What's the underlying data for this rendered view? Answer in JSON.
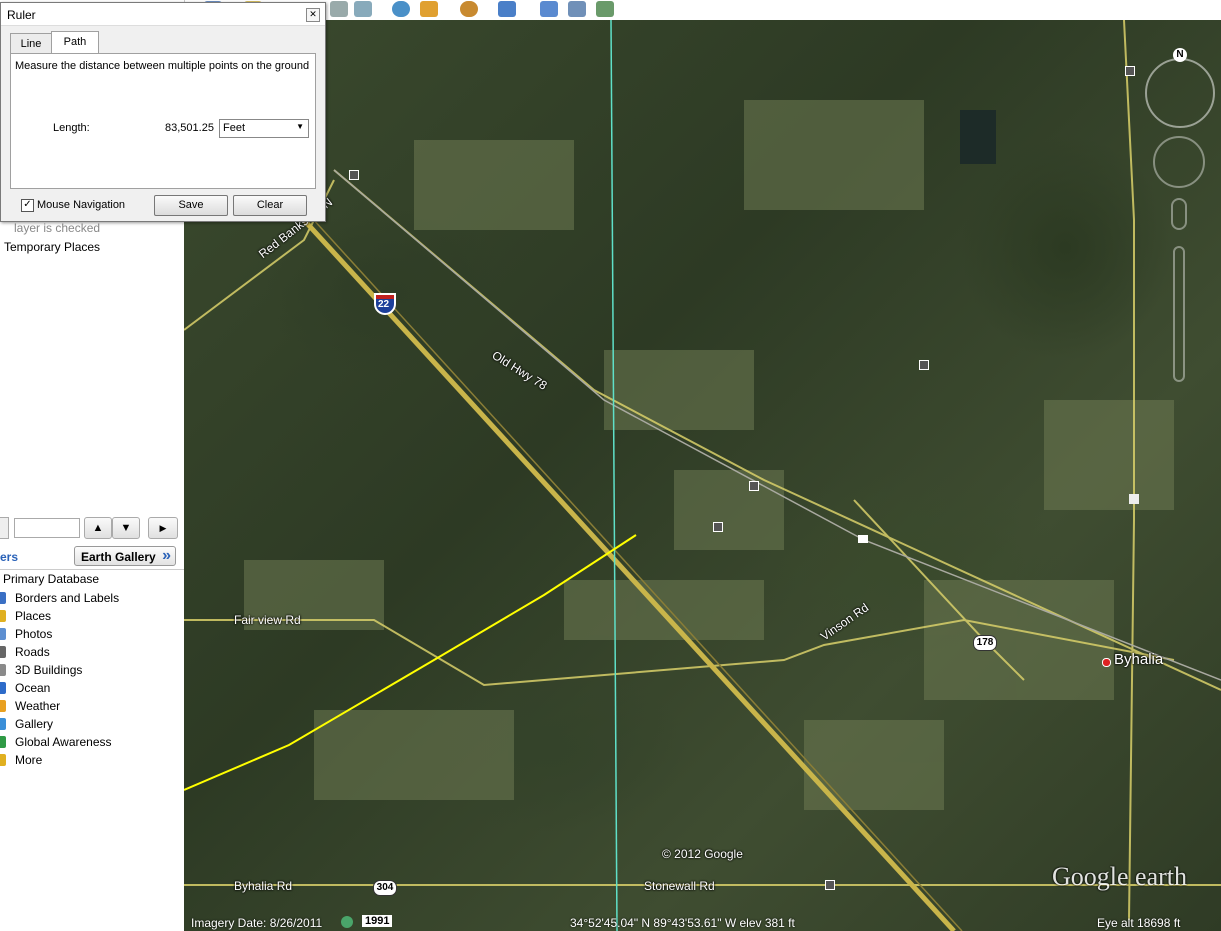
{
  "ruler": {
    "title": "Ruler",
    "tabs": [
      {
        "label": "Line"
      },
      {
        "label": "Path"
      }
    ],
    "description": "Measure the distance between multiple points on the ground",
    "length_label": "Length:",
    "length_value": "83,501.25",
    "unit": "Feet",
    "mouse_navigation_label": "Mouse Navigation",
    "mouse_navigation_checked": true,
    "save_label": "Save",
    "clear_label": "Clear"
  },
  "sidebar": {
    "partial_text": "layer is checked",
    "temporary_places": "Temporary Places",
    "layers_header": "ers",
    "earth_gallery": "Earth Gallery",
    "earth_gallery_chevron": "»",
    "primary_database": "Primary Database",
    "layers": [
      {
        "label": "Borders and Labels",
        "icon": "borders-icon",
        "color": "#3a6fc4"
      },
      {
        "label": "Places",
        "icon": "places-icon",
        "color": "#e0b020"
      },
      {
        "label": "Photos",
        "icon": "photos-icon",
        "color": "#5d8fd1"
      },
      {
        "label": "Roads",
        "icon": "roads-icon",
        "color": "#666666"
      },
      {
        "label": "3D Buildings",
        "icon": "buildings-icon",
        "color": "#8a8a8a"
      },
      {
        "label": "Ocean",
        "icon": "ocean-icon",
        "color": "#2d6bc9"
      },
      {
        "label": "Weather",
        "icon": "weather-icon",
        "color": "#e8a020"
      },
      {
        "label": "Gallery",
        "icon": "gallery-icon",
        "color": "#3b8fd8"
      },
      {
        "label": "Global Awareness",
        "icon": "globe-icon",
        "color": "#2f9a45"
      },
      {
        "label": "More",
        "icon": "more-icon",
        "color": "#e0b020"
      }
    ]
  },
  "map": {
    "labels": {
      "red_banks": "Red Banks Rd N",
      "old_hwy": "Old Hwy 78",
      "fairview": "Fair view Rd",
      "vinson": "Vinson Rd",
      "byhalia_rd": "Byhalia Rd",
      "stonewall": "Stonewall Rd",
      "byhalia": "Byhalia",
      "copyright": "© 2012 Google",
      "google_earth": "Google earth"
    },
    "shields": {
      "interstate": "22",
      "us178": "178",
      "sr304": "304"
    },
    "compass_n": "N"
  },
  "status": {
    "imagery_date": "Imagery Date: 8/26/2011",
    "year": "1991",
    "coords": "34°52'45.04\" N  89°43'53.61\" W  elev   381 ft",
    "eye_alt": "Eye alt  18698 ft"
  }
}
